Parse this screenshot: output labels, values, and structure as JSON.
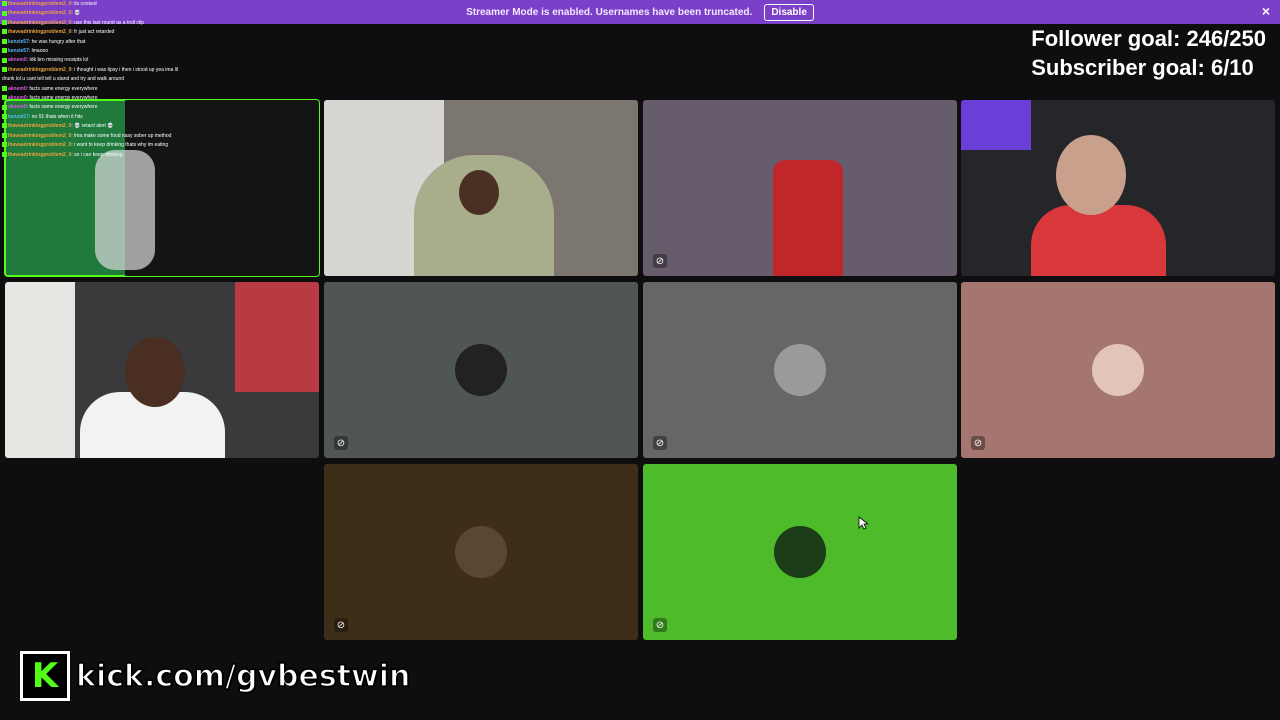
{
  "banner": {
    "message": "Streamer Mode is enabled. Usernames have been truncated.",
    "disable_label": "Disable",
    "close_glyph": "×"
  },
  "goals": {
    "follower": "Follower goal: 246/250",
    "subscriber": "Subscriber goal: 6/10"
  },
  "chat": [
    {
      "user": "ihaveadrinkingproblem2_0",
      "text": ": its cooked",
      "color": "#e8a33d"
    },
    {
      "user": "ihaveadrinkingproblem2_0",
      "text": ": 💀",
      "color": "#e8a33d"
    },
    {
      "user": "ihaveadrinkingproblem2_0",
      "text": ": use this last round as a troll clip",
      "color": "#e8a33d"
    },
    {
      "user": "ihaveadrinkingproblem2_0",
      "text": ": fr just act retarded",
      "color": "#e8a33d"
    },
    {
      "user": "kenzie57",
      "text": ": he was hungry after that",
      "color": "#5bb8f5"
    },
    {
      "user": "kenzie57",
      "text": ": lmaooo",
      "color": "#5bb8f5"
    },
    {
      "user": "aknem0",
      "text": ": Idk bro missing receipts lol",
      "color": "#d65ae0"
    },
    {
      "user": "ihaveadrinkingproblem2_0",
      "text": ": i thought i was tipsy i then i stood up yea ima lil",
      "color": "#e8a33d"
    },
    {
      "user": "",
      "text": "drunk lol u cant tell tell u stand and try and walk around",
      "color": "#e8a33d"
    },
    {
      "user": "aknem0",
      "text": ": facts same energy everywhere",
      "color": "#d65ae0"
    },
    {
      "user": "aknem0",
      "text": ": facts same energy everywhere",
      "color": "#d65ae0"
    },
    {
      "user": "aknem0",
      "text": ": facts same energy everywhere",
      "color": "#d65ae0"
    },
    {
      "user": "kenzie57",
      "text": ": no 01 thats when it hits",
      "color": "#5bb8f5"
    },
    {
      "user": "ihaveadrinkingproblem2_0",
      "text": ": 💀 retard alert 💀",
      "color": "#e8a33d"
    },
    {
      "user": "ihaveadrinkingproblem2_0",
      "text": ": lma make some food nasy sober up method",
      "color": "#e8a33d"
    },
    {
      "user": "ihaveadrinkingproblem2_0",
      "text": ": i want to keep drinking thats why im eating",
      "color": "#e8a33d"
    },
    {
      "user": "ihaveadrinkingproblem2_0",
      "text": ": so i can keep drinking",
      "color": "#e8a33d"
    }
  ],
  "kick": {
    "logo_letter": "K",
    "url": "kick.com/gvbestwin"
  }
}
